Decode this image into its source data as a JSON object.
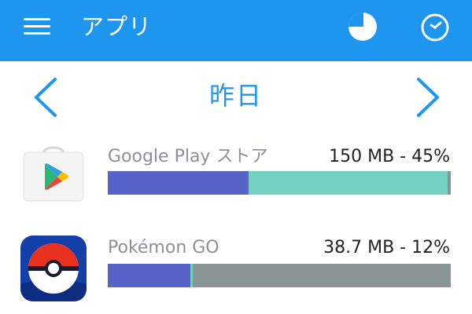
{
  "header": {
    "title": "アプリ",
    "icons": [
      "menu-icon",
      "pie-chart-icon",
      "clock-icon"
    ]
  },
  "date_nav": {
    "label": "昨日"
  },
  "apps": [
    {
      "name": "Google Play ストア",
      "usage": "150 MB - 45%",
      "usage_mb": 150,
      "usage_percent": 45,
      "segments": [
        {
          "fraction": 0.41,
          "color": "#5763c9"
        },
        {
          "fraction": 0.58,
          "color": "#74d1c0"
        }
      ]
    },
    {
      "name": "Pokémon GO",
      "usage": "38.7 MB - 12%",
      "usage_mb": 38.7,
      "usage_percent": 12,
      "segments": [
        {
          "fraction": 0.24,
          "color": "#5763c9"
        },
        {
          "fraction": 0.007,
          "color": "#74d1c0"
        }
      ]
    }
  ],
  "colors": {
    "appbar": "#1e96f0",
    "accent": "#1e96f0",
    "bar_background": "#8a9494"
  }
}
